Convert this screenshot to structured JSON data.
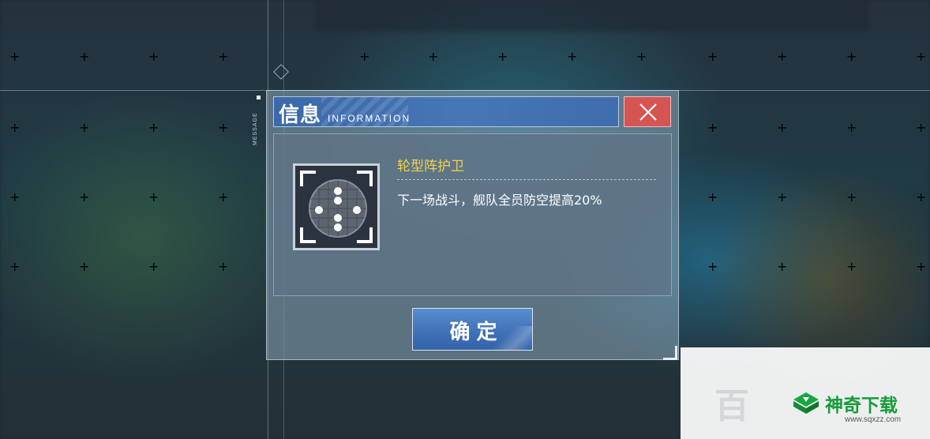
{
  "dialog": {
    "side_label": "MESSAGE",
    "title_cn": "信息",
    "title_en": "INFORMATION",
    "close_icon": "close-icon"
  },
  "item": {
    "icon": "formation-icon",
    "name": "轮型阵护卫",
    "description": "下一场战斗，舰队全员防空提高20%"
  },
  "actions": {
    "confirm_label": "确定"
  },
  "watermark": {
    "faint_text": "百",
    "brand": "神奇下载",
    "url": "www.sqxzz.com"
  },
  "colors": {
    "title_blue": "#4676b5",
    "close_red": "#d65552",
    "item_name_yellow": "#f3d24a"
  }
}
